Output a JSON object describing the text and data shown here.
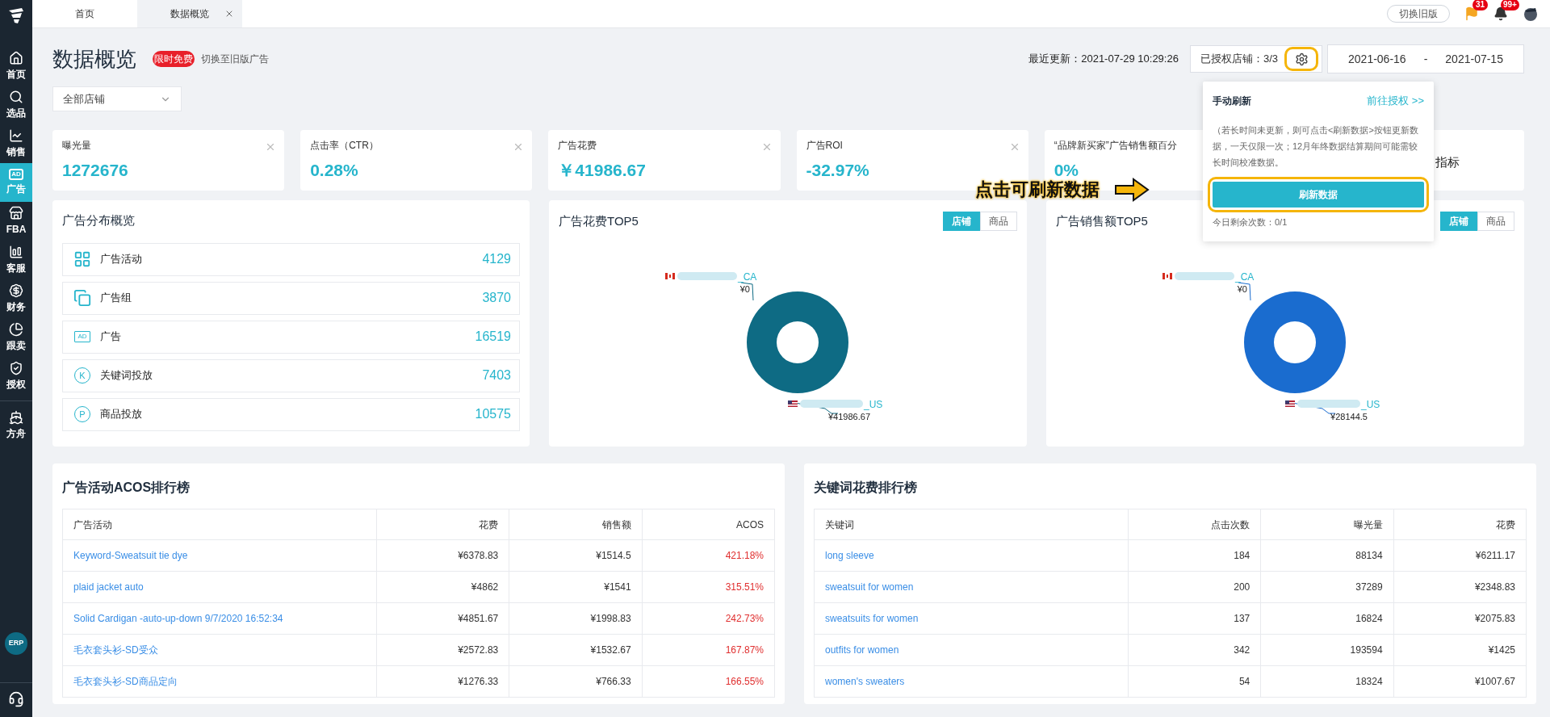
{
  "sidebar": {
    "items": [
      {
        "label": "首页",
        "kind": "home",
        "selected": false
      },
      {
        "label": "选品",
        "kind": "search",
        "selected": false
      },
      {
        "label": "销售",
        "kind": "trend",
        "selected": false
      },
      {
        "label": "广告",
        "kind": "ad",
        "icon_text": "AD",
        "selected": true
      },
      {
        "label": "FBA",
        "kind": "store",
        "selected": false
      },
      {
        "label": "客服",
        "kind": "bars",
        "selected": false
      },
      {
        "label": "财务",
        "kind": "dollar",
        "selected": false
      },
      {
        "label": "跟卖",
        "kind": "pie",
        "selected": false
      },
      {
        "label": "授权",
        "kind": "shield",
        "selected": false
      },
      {
        "label": "方舟",
        "kind": "ship",
        "selected": false
      }
    ],
    "erp": "ERP"
  },
  "tabs": [
    {
      "label": "首页",
      "selected": false,
      "closable": false
    },
    {
      "label": "数据概览",
      "selected": true,
      "closable": true
    }
  ],
  "topbar": {
    "switch_button": "切换旧版",
    "flag_badge": "31",
    "bell_badge": "99+"
  },
  "header": {
    "title": "数据概览",
    "badge": "限时免费",
    "switch_link": "切换至旧版广告",
    "last_update": "最近更新：2021-07-29 10:29:26",
    "authorized": "已授权店铺：3/3",
    "date_from": "2021-06-16",
    "date_sep": "-",
    "date_to": "2021-07-15"
  },
  "store_select": {
    "value": "全部店铺"
  },
  "cards": [
    {
      "title": "曝光量",
      "value": "1272676",
      "closable": true
    },
    {
      "title": "点击率（CTR）",
      "value": "0.28%",
      "closable": true
    },
    {
      "title": "广告花费",
      "value": "￥41986.67",
      "closable": true
    },
    {
      "title": "广告ROI",
      "value": "-32.97%",
      "closable": true
    },
    {
      "title": "“品牌新买家”广告销售额百分",
      "value": "0%",
      "closable": false
    },
    {
      "title": "指标",
      "closable": false
    }
  ],
  "popup": {
    "title": "手动刷新",
    "link": "前往授权 >>",
    "text": "（若长时间未更新，则可点击<刷新数据>按钮更新数据，一天仅限一次；12月年终数据结算期间可能需较长时间校准数据。",
    "button": "刷新数据",
    "remaining": "今日剩余次数：0/1"
  },
  "annotation": {
    "text": "点击可刷新数据"
  },
  "overview": {
    "title": "广告分布概览",
    "items": [
      {
        "kind": "grid",
        "label": "广告活动",
        "count": "4129"
      },
      {
        "kind": "copy",
        "label": "广告组",
        "count": "3870"
      },
      {
        "kind": "ad",
        "icon_text": "AD",
        "label": "广告",
        "count": "16519"
      },
      {
        "kind": "circle",
        "icon_text": "K",
        "label": "关键词投放",
        "count": "7403"
      },
      {
        "kind": "circle",
        "icon_text": "P",
        "label": "商品投放",
        "count": "10575"
      }
    ]
  },
  "top5": [
    {
      "title": "广告花费TOP5",
      "toggle": [
        {
          "label": "店铺",
          "selected": true
        },
        {
          "label": "商品",
          "selected": false
        }
      ],
      "color": "#0e6b84",
      "chart_data": {
        "type": "pie",
        "categories": [
          "_CA",
          "_US"
        ],
        "values": [
          0,
          41986.67
        ],
        "value_labels": [
          "¥0",
          "¥41986.67"
        ]
      }
    },
    {
      "title": "广告销售额TOP5",
      "toggle": [
        {
          "label": "店铺",
          "selected": true
        },
        {
          "label": "商品",
          "selected": false
        }
      ],
      "color": "#1a6ccf",
      "chart_data": {
        "type": "pie",
        "categories": [
          "_CA",
          "_US"
        ],
        "values": [
          0,
          28144.5
        ],
        "value_labels": [
          "¥0",
          "¥28144.5"
        ]
      }
    }
  ],
  "tables": [
    {
      "title": "广告活动ACOS排行榜",
      "columns": [
        "广告活动",
        "花费",
        "销售额",
        "ACOS"
      ],
      "rows": [
        [
          "Keyword-Sweatsuit tie dye",
          "¥6378.83",
          "¥1514.5",
          "421.18%"
        ],
        [
          "plaid jacket auto",
          "¥4862",
          "¥1541",
          "315.51%"
        ],
        [
          "Solid Cardigan -auto-up-down 9/7/2020 16:52:34",
          "¥4851.67",
          "¥1998.83",
          "242.73%"
        ],
        [
          "毛衣套头衫-SD受众",
          "¥2572.83",
          "¥1532.67",
          "167.87%"
        ],
        [
          "毛衣套头衫-SD商品定向",
          "¥1276.33",
          "¥766.33",
          "166.55%"
        ]
      ],
      "kind": "acos"
    },
    {
      "title": "关键词花费排行榜",
      "columns": [
        "关键词",
        "点击次数",
        "曝光量",
        "花费"
      ],
      "rows": [
        [
          "long sleeve",
          "184",
          "88134",
          "¥6211.17"
        ],
        [
          "sweatsuit for women",
          "200",
          "37289",
          "¥2348.83"
        ],
        [
          "sweatsuits for women",
          "137",
          "16824",
          "¥2075.83"
        ],
        [
          "outfits for women",
          "342",
          "193594",
          "¥1425"
        ],
        [
          "women's sweaters",
          "54",
          "18324",
          "¥1007.67"
        ]
      ],
      "kind": "keyword"
    }
  ]
}
